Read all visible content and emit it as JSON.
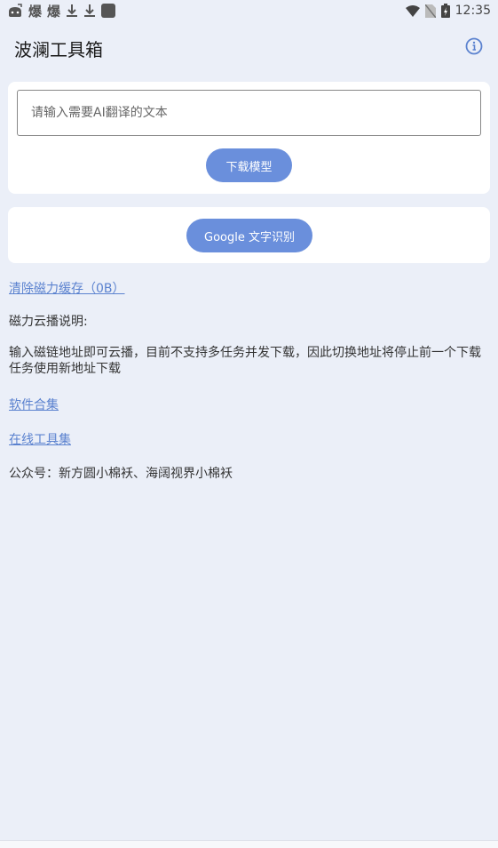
{
  "status_bar": {
    "left_icons": [
      "game-controller-icon",
      "burst-icon",
      "burst-icon",
      "download-icon",
      "download-icon",
      "square-icon"
    ],
    "burst_glyph": "爆",
    "right_icons": [
      "wifi-icon",
      "no-sim-icon",
      "battery-charging-icon"
    ],
    "time": "12:35"
  },
  "app_bar": {
    "title": "波澜工具箱",
    "info_icon": "info-icon"
  },
  "translate_card": {
    "input_value": "",
    "input_placeholder": "请输入需要AI翻译的文本",
    "download_button": "下载模型"
  },
  "ocr_card": {
    "ocr_button": "Google 文字识别"
  },
  "links": {
    "clear_cache": "清除磁力缓存（0B）",
    "software_collection": "软件合集",
    "online_tools": "在线工具集"
  },
  "info": {
    "magnet_heading": "磁力云播说明:",
    "magnet_description": "输入磁链地址即可云播，目前不支持多任务并发下载，因此切换地址将停止前一个下载任务使用新地址下载",
    "wechat_accounts": "公众号：新方圆小棉袄、海阔视界小棉袄"
  },
  "colors": {
    "accent": "#6a8fdc",
    "link": "#5b82cf",
    "background": "#ebeff8"
  }
}
